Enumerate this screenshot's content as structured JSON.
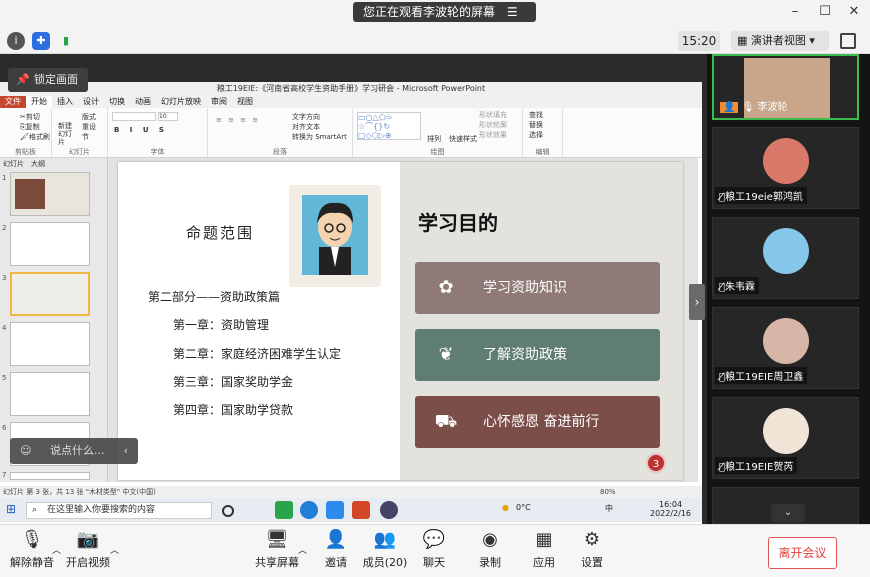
{
  "sharing_banner": {
    "text": "您正在观看李波轮的屏幕",
    "menu_icon": "menu-icon"
  },
  "window_controls": [
    "minimize-icon",
    "restore-icon",
    "close-icon"
  ],
  "top_toolbar": {
    "time": "15:20",
    "view_mode": "演讲者视图",
    "icons": [
      "info-icon",
      "shield-icon",
      "signal-icon"
    ]
  },
  "lock_screen_label": "锁定画面",
  "powerpoint": {
    "title": "粮工19EIE:《河南省高校学生资助手册》学习研会 - Microsoft PowerPoint",
    "tabs": [
      "文件",
      "开始",
      "插入",
      "设计",
      "切换",
      "动画",
      "幻灯片放映",
      "审阅",
      "视图"
    ],
    "ribbon_groups": [
      "剪贴板",
      "幻灯片",
      "字体",
      "段落",
      "绘图",
      "编辑"
    ],
    "ribbon_items": {
      "cut": "剪切",
      "copy": "复制",
      "format_painter": "格式刷",
      "new_slide": "新建幻灯片",
      "layout": "版式",
      "reset": "重设",
      "section": "节",
      "text_direction": "文字方向",
      "align_text": "对齐文本",
      "smartart": "转换为 SmartArt",
      "arrange": "排列",
      "quick_styles": "快速样式",
      "shape_fill": "形状填充",
      "shape_outline": "形状轮廓",
      "shape_effects": "形状效果",
      "find": "查找",
      "replace": "替换",
      "select": "选择",
      "font_size": "10"
    },
    "panel_tabs": [
      "幻灯片",
      "大纲"
    ],
    "thumb_numbers": [
      "1",
      "2",
      "3",
      "4",
      "5",
      "6",
      "7"
    ],
    "status": "幻灯片 第 3 张，共 13 张   \"木材类型\"   中文(中国)",
    "zoom": "80%"
  },
  "slide": {
    "left_title": "命题范围",
    "part": "第二部分——资助政策篇",
    "chapters": [
      "第一章：资助管理",
      "第二章：家庭经济困难学生认定",
      "第三章：国家奖助学金",
      "第四章：国家助学贷款"
    ],
    "right_title": "学习目的",
    "goals": [
      {
        "text": "学习资助知识",
        "icon": "plant-pot-icon",
        "color": "#8f7a77"
      },
      {
        "text": "了解资助政策",
        "icon": "sprout-icon",
        "color": "#5f7d72"
      },
      {
        "text": "心怀感恩 奋进前行",
        "icon": "truck-icon",
        "color": "#7b4e4a"
      }
    ],
    "page_number": "3"
  },
  "chat_bubble_placeholder": "说点什么...",
  "taskbar": {
    "search_placeholder": "在这里输入你要搜索的内容",
    "weather": "0°C",
    "time": "16:04",
    "date": "2022/2/16",
    "ime": "中"
  },
  "participants": [
    {
      "name": "李波轮",
      "mic_icon": "mic-icon"
    },
    {
      "name": "粮工19eie郭鸿凯"
    },
    {
      "name": "朱韦霖"
    },
    {
      "name": "粮工19EIE周卫鑫"
    },
    {
      "name": "粮工19EIE贺芮"
    }
  ],
  "bottom_bar": [
    {
      "label": "解除静音",
      "icon": "mic-muted-icon"
    },
    {
      "label": "开启视频",
      "icon": "camera-off-icon"
    },
    {
      "label": "共享屏幕",
      "icon": "share-screen-icon"
    },
    {
      "label": "邀请",
      "icon": "invite-icon"
    },
    {
      "label": "成员(20)",
      "icon": "members-icon"
    },
    {
      "label": "聊天",
      "icon": "chat-icon"
    },
    {
      "label": "录制",
      "icon": "record-icon"
    },
    {
      "label": "应用",
      "icon": "apps-icon"
    },
    {
      "label": "设置",
      "icon": "settings-icon"
    }
  ],
  "leave_button": "离开会议"
}
